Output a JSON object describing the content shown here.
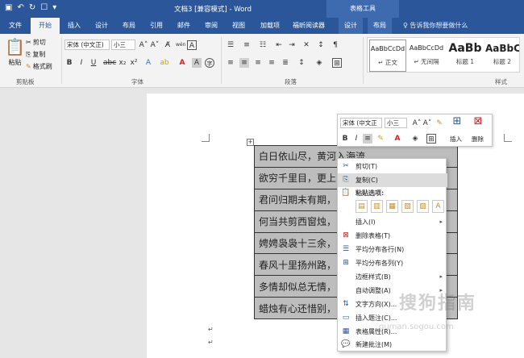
{
  "titlebar": {
    "title": "文档3 [兼容模式] - Word",
    "context_group": "表格工具",
    "qa_icons": [
      "save-icon",
      "undo-icon",
      "repeat-icon",
      "touch-mode-icon",
      "customize-icon"
    ]
  },
  "tabs": [
    {
      "label": "文件"
    },
    {
      "label": "开始"
    },
    {
      "label": "插入"
    },
    {
      "label": "设计"
    },
    {
      "label": "布局"
    },
    {
      "label": "引用"
    },
    {
      "label": "邮件"
    },
    {
      "label": "审阅"
    },
    {
      "label": "视图"
    },
    {
      "label": "加载项"
    },
    {
      "label": "福昕阅读器"
    },
    {
      "label": "设计"
    },
    {
      "label": "布局"
    }
  ],
  "tell_me": "♀ 告诉我你想要做什么",
  "ribbon": {
    "clipboard": {
      "paste": "粘贴",
      "cut": "剪切",
      "copy": "复制",
      "format_painter": "格式刷",
      "group": "剪贴板"
    },
    "font": {
      "name": "宋体 (中文正)",
      "size": "小三",
      "group": "字体",
      "wen": "wén",
      "a_box": "A"
    },
    "paragraph": {
      "group": "段落"
    },
    "styles": {
      "group": "样式",
      "items": [
        {
          "preview": "AaBbCcDd",
          "name": "↵ 正文"
        },
        {
          "preview": "AaBbCcDd",
          "name": "↵ 无间隔"
        },
        {
          "preview": "AaBb",
          "name": "标题 1"
        },
        {
          "preview": "AaBbC",
          "name": "标题 2"
        }
      ]
    }
  },
  "document": {
    "poem_rows": [
      "白日依山尽，黄河入海流",
      "欲穷千里目，更上",
      "君问归期未有期，",
      "何当共剪西窗烛，",
      "娉娉袅袅十三余，",
      "春风十里扬州路，",
      "多情却似总无情，",
      "蜡烛有心还惜别，"
    ],
    "para_mark": "↵"
  },
  "mini_toolbar": {
    "font": "宋体 (中文正",
    "size": "小三",
    "insert": "插入",
    "delete": "删除"
  },
  "context_menu": {
    "items": [
      {
        "label": "剪切(T)",
        "icon": "scissors-icon"
      },
      {
        "label": "复制(C)",
        "icon": "copy-icon"
      },
      {
        "label": "粘贴选项:",
        "icon": "clipboard-icon"
      },
      {
        "label": "插入(I)",
        "icon": ""
      },
      {
        "label": "删除表格(T)",
        "icon": "delete-table-icon"
      },
      {
        "label": "平均分布各行(N)",
        "icon": "distribute-rows-icon"
      },
      {
        "label": "平均分布各列(Y)",
        "icon": "distribute-columns-icon"
      },
      {
        "label": "边框样式(B)",
        "icon": ""
      },
      {
        "label": "自动调整(A)",
        "icon": ""
      },
      {
        "label": "文字方向(X)...",
        "icon": "text-direction-icon"
      },
      {
        "label": "插入题注(C)...",
        "icon": "caption-icon"
      },
      {
        "label": "表格属性(R)...",
        "icon": "table-properties-icon"
      },
      {
        "label": "新建批注(M)",
        "icon": "comment-icon"
      }
    ]
  },
  "watermark": {
    "text": "搜狗指南",
    "sub": "guman.sogou.com"
  },
  "colors": {
    "brand": "#2b579a",
    "context_tab": "#3e6bb0",
    "cell_shade": "#bdbdbd"
  }
}
